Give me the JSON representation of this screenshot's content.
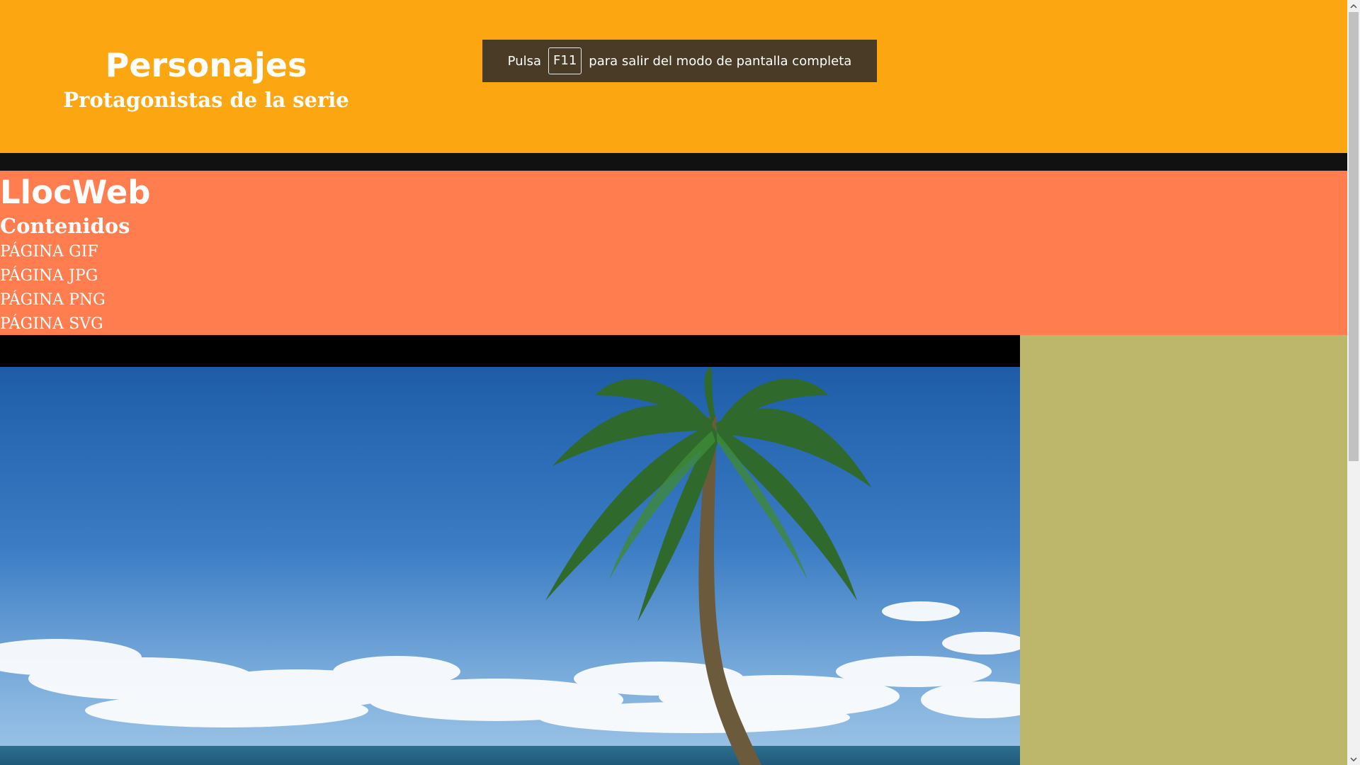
{
  "header": {
    "title": "Personajes",
    "subtitle": "Protagonistas de la serie"
  },
  "fullscreen_toast": {
    "prefix": "Pulsa",
    "key": "F11",
    "suffix": "para salir del modo de pantalla completa"
  },
  "nav": {
    "brand": "LlocWeb",
    "contents_title": "Contenidos",
    "links": [
      "PÁGINA GIF",
      "PÁGINA JPG",
      "PÁGINA PNG",
      "PÁGINA SVG"
    ]
  },
  "colors": {
    "header_bg": "#fca712",
    "nav_bg": "#ff7d4e",
    "aside_bg": "#bdb76b",
    "toast_bg": "#4a3b27"
  },
  "icons": {
    "scroll_up": "chevron-up-icon",
    "scroll_down": "chevron-down-icon"
  }
}
